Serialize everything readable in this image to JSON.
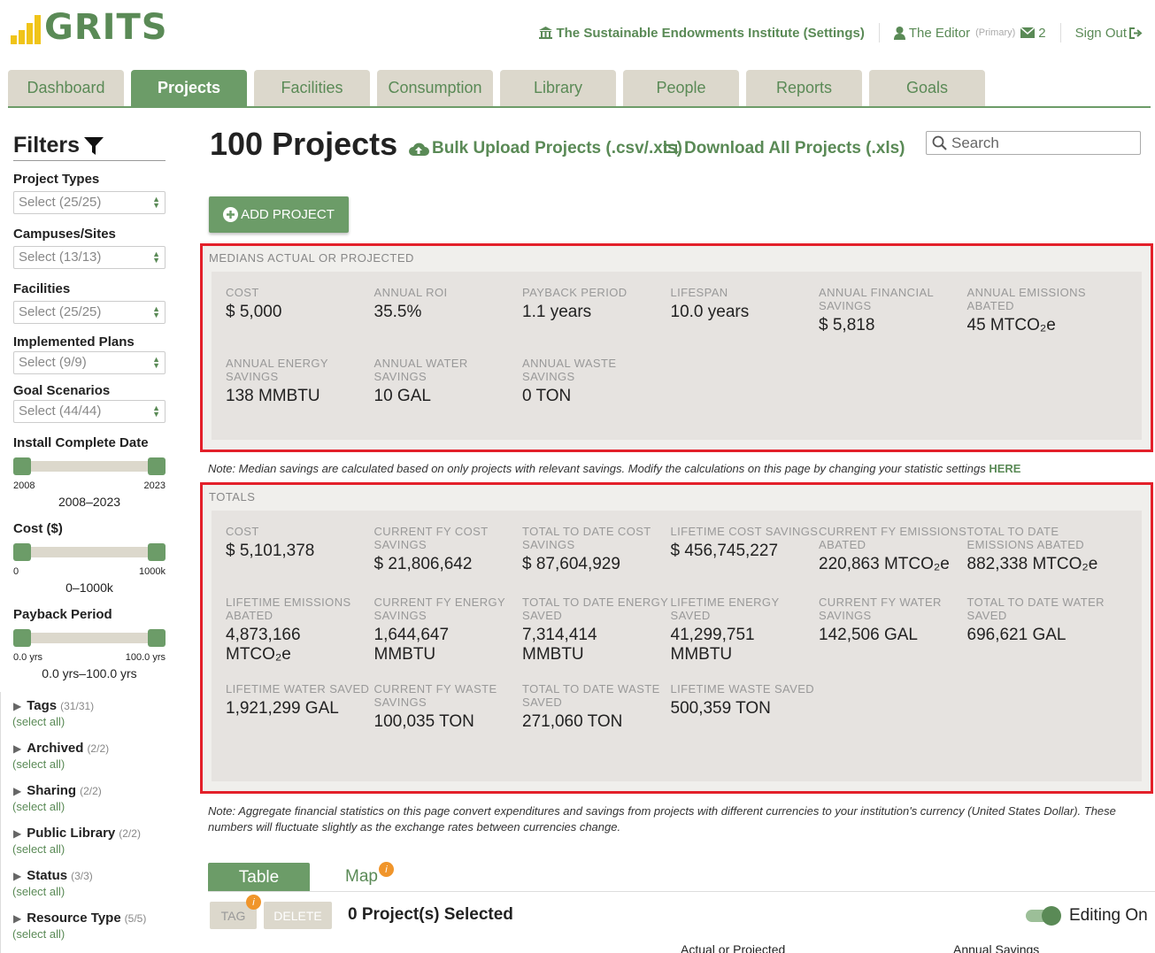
{
  "app": {
    "logo_text": "GRITS"
  },
  "topnav": {
    "institution": "The Sustainable Endowments Institute (Settings)",
    "user": "The Editor",
    "user_role": "(Primary)",
    "messages": "2",
    "signout": "Sign Out"
  },
  "tabs": [
    "Dashboard",
    "Projects",
    "Facilities",
    "Consumption",
    "Library",
    "People",
    "Reports",
    "Goals"
  ],
  "sidebar": {
    "title": "Filters",
    "selects": [
      {
        "label": "Project Types",
        "value": "Select (25/25)"
      },
      {
        "label": "Campuses/Sites",
        "value": "Select (13/13)"
      },
      {
        "label": "Facilities",
        "value": "Select (25/25)"
      },
      {
        "label": "Implemented Plans",
        "value": "Select (9/9)"
      },
      {
        "label": "Goal Scenarios",
        "value": "Select (44/44)"
      }
    ],
    "sliders": [
      {
        "label": "Install Complete Date",
        "min": "2008",
        "max": "2023",
        "range": "2008–2023"
      },
      {
        "label": "Cost ($)",
        "min": "0",
        "max": "1000k",
        "range": "0–1000k"
      },
      {
        "label": "Payback Period",
        "min": "0.0 yrs",
        "max": "100.0 yrs",
        "range": "0.0 yrs–100.0 yrs"
      }
    ],
    "collapsibles": [
      {
        "label": "Tags",
        "count": "(31/31)",
        "select_all": "(select all)"
      },
      {
        "label": "Archived",
        "count": "(2/2)",
        "select_all": "(select all)"
      },
      {
        "label": "Sharing",
        "count": "(2/2)",
        "select_all": "(select all)"
      },
      {
        "label": "Public Library",
        "count": "(2/2)",
        "select_all": "(select all)"
      },
      {
        "label": "Status",
        "count": "(3/3)",
        "select_all": "(select all)"
      },
      {
        "label": "Resource Type",
        "count": "(5/5)",
        "select_all": "(select all)"
      }
    ]
  },
  "main": {
    "title": "100 Projects",
    "bulk_upload": "Bulk Upload Projects (.csv/.xls)",
    "download": "Download All Projects (.xls)",
    "search_placeholder": "Search",
    "add_project": "ADD PROJECT"
  },
  "medians": {
    "heading": "MEDIANS ACTUAL OR PROJECTED",
    "stats": [
      {
        "label": "COST",
        "value": "$ 5,000"
      },
      {
        "label": "ANNUAL ROI",
        "value": "35.5%"
      },
      {
        "label": "PAYBACK PERIOD",
        "value": "1.1 years"
      },
      {
        "label": "LIFESPAN",
        "value": "10.0 years"
      },
      {
        "label": "ANNUAL FINANCIAL SAVINGS",
        "value": "$ 5,818"
      },
      {
        "label": "ANNUAL EMISSIONS ABATED",
        "value": "45 MTCO₂e"
      },
      {
        "label": "ANNUAL ENERGY SAVINGS",
        "value": "138 MMBTU"
      },
      {
        "label": "ANNUAL WATER SAVINGS",
        "value": "10 GAL"
      },
      {
        "label": "ANNUAL WASTE SAVINGS",
        "value": "0 TON"
      }
    ]
  },
  "median_note": {
    "text": "Note: Median savings are calculated based on only projects with relevant savings. Modify the calculations on this page by changing your statistic settings ",
    "link": "HERE"
  },
  "totals": {
    "heading": "TOTALS",
    "stats": [
      {
        "label": "COST",
        "value": "$ 5,101,378"
      },
      {
        "label": "CURRENT FY COST SAVINGS",
        "value": "$ 21,806,642"
      },
      {
        "label": "TOTAL TO DATE COST SAVINGS",
        "value": "$ 87,604,929"
      },
      {
        "label": "LIFETIME COST SAVINGS",
        "value": "$ 456,745,227"
      },
      {
        "label": "CURRENT FY EMISSIONS ABATED",
        "value": "220,863 MTCO₂e"
      },
      {
        "label": "TOTAL TO DATE EMISSIONS ABATED",
        "value": "882,338 MTCO₂e"
      },
      {
        "label": "LIFETIME EMISSIONS ABATED",
        "value": "4,873,166 MTCO₂e"
      },
      {
        "label": "CURRENT FY ENERGY SAVINGS",
        "value": "1,644,647 MMBTU"
      },
      {
        "label": "TOTAL TO DATE ENERGY SAVED",
        "value": "7,314,414 MMBTU"
      },
      {
        "label": "LIFETIME ENERGY SAVED",
        "value": "41,299,751 MMBTU"
      },
      {
        "label": "CURRENT FY WATER SAVINGS",
        "value": "142,506 GAL"
      },
      {
        "label": "TOTAL TO DATE WATER SAVED",
        "value": "696,621 GAL"
      },
      {
        "label": "LIFETIME WATER SAVED",
        "value": "1,921,299 GAL"
      },
      {
        "label": "CURRENT FY WASTE SAVINGS",
        "value": "100,035 TON"
      },
      {
        "label": "TOTAL TO DATE WASTE SAVED",
        "value": "271,060 TON"
      },
      {
        "label": "LIFETIME WASTE SAVED",
        "value": "500,359 TON"
      }
    ]
  },
  "totals_note": "Note: Aggregate financial statistics on this page convert expenditures and savings from projects with different currencies to your institution's currency (United States Dollar). These numbers will fluctuate slightly as the exchange rates between currencies change.",
  "bottom": {
    "tab_table": "Table",
    "tab_map": "Map",
    "badge": "i",
    "tag_button": "TAG",
    "delete_button": "DELETE",
    "selected": "0 Project(s) Selected",
    "editing": "Editing On",
    "col_actual": "Actual or Projected",
    "col_annual": "Annual Savings"
  },
  "colors": {
    "accent": "#6c9c68",
    "highlight_border": "#e3202a",
    "logo_bars": "#f0c419",
    "badge": "#f0952b"
  }
}
